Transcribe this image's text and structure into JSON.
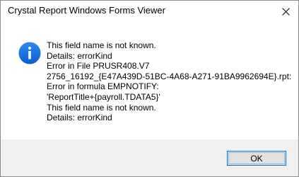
{
  "window": {
    "title": "Crystal Report Windows Forms Viewer"
  },
  "icons": {
    "info": "info-icon",
    "close": "close-icon",
    "info_color": "#1a73e8"
  },
  "message": {
    "lines": [
      "This field name is not known.",
      "Details: errorKind",
      "Error in File PRUSR408.V7",
      "2756_16192_{E47A439D-51BC-4A68-A271-91BA9962694E}.rpt:",
      "Error in formula  EMPNOTIFY:",
      "'ReportTitle+{payroll.TDATA5}'",
      "This field name is not known.",
      "Details: errorKind"
    ]
  },
  "buttons": {
    "ok_label": "OK"
  }
}
